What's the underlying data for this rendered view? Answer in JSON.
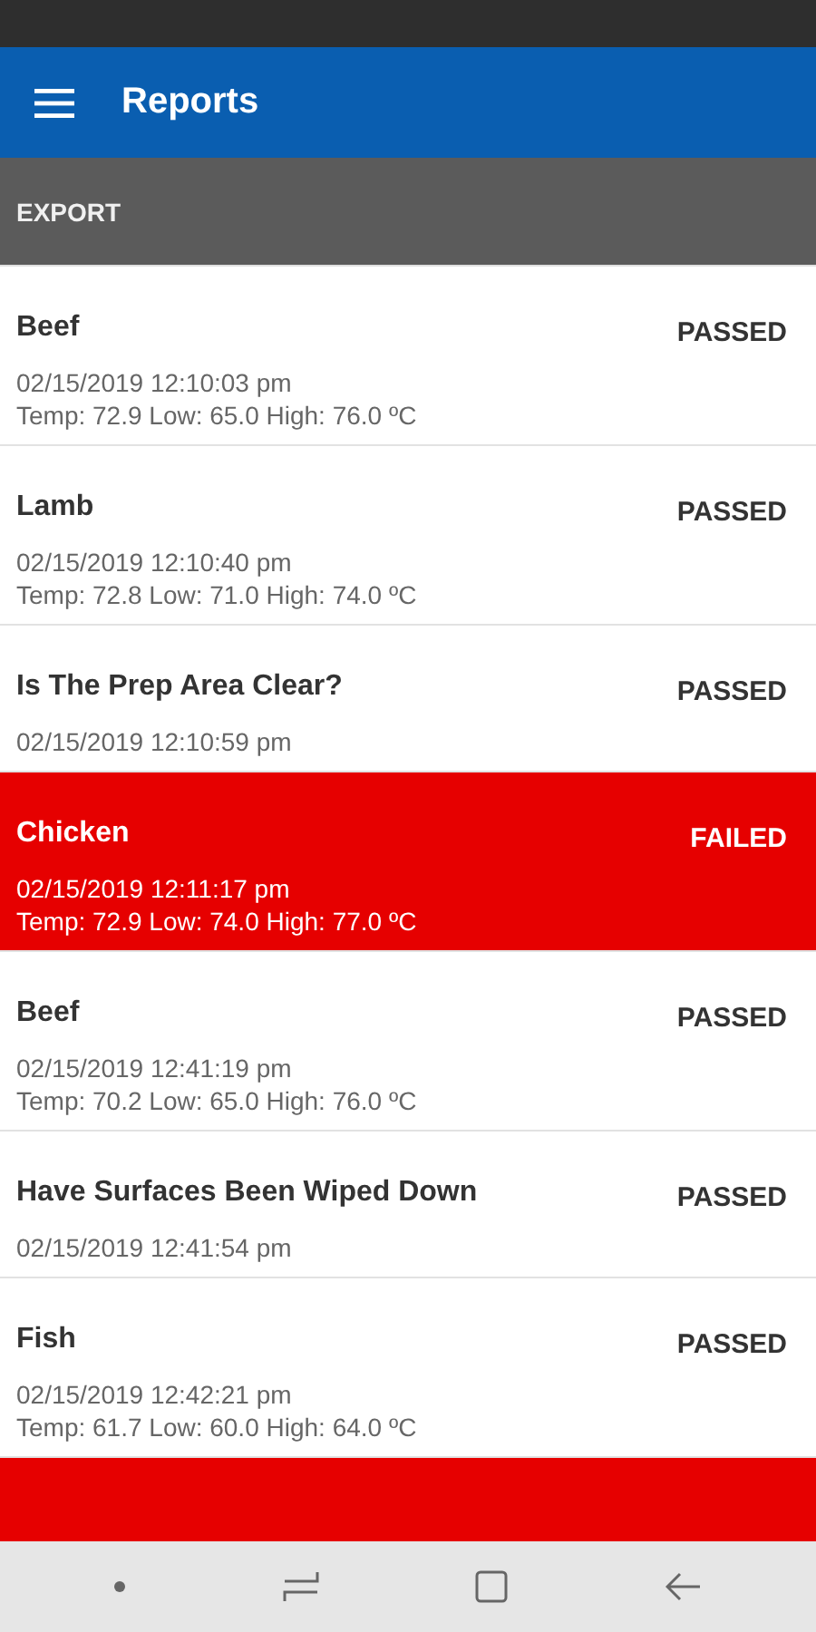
{
  "app_bar": {
    "title": "Reports"
  },
  "toolbar": {
    "action": "EXPORT"
  },
  "reports": [
    {
      "name": "Beef",
      "result": "PASSED",
      "failed": false,
      "date": "02/15/2019 12:10:03 pm",
      "reading": "Temp: 72.9 Low: 65.0 High: 76.0 ºC"
    },
    {
      "name": "Lamb",
      "result": "PASSED",
      "failed": false,
      "date": "02/15/2019 12:10:40 pm",
      "reading": "Temp: 72.8 Low: 71.0 High: 74.0 ºC"
    },
    {
      "name": "Is The Prep Area Clear?",
      "result": "PASSED",
      "failed": false,
      "date": "02/15/2019 12:10:59 pm"
    },
    {
      "name": "Chicken",
      "result": "FAILED",
      "failed": true,
      "date": "02/15/2019 12:11:17 pm",
      "reading": "Temp: 72.9 Low: 74.0 High: 77.0 ºC"
    },
    {
      "name": "Beef",
      "result": "PASSED",
      "failed": false,
      "date": "02/15/2019 12:41:19 pm",
      "reading": "Temp: 70.2 Low: 65.0 High: 76.0 ºC"
    },
    {
      "name": "Have Surfaces Been Wiped Down",
      "result": "PASSED",
      "failed": false,
      "date": "02/15/2019 12:41:54 pm"
    },
    {
      "name": "Fish",
      "result": "PASSED",
      "failed": false,
      "date": "02/15/2019 12:42:21 pm",
      "reading": "Temp: 61.7 Low: 60.0 High: 64.0 ºC"
    },
    {
      "failed": true
    }
  ]
}
